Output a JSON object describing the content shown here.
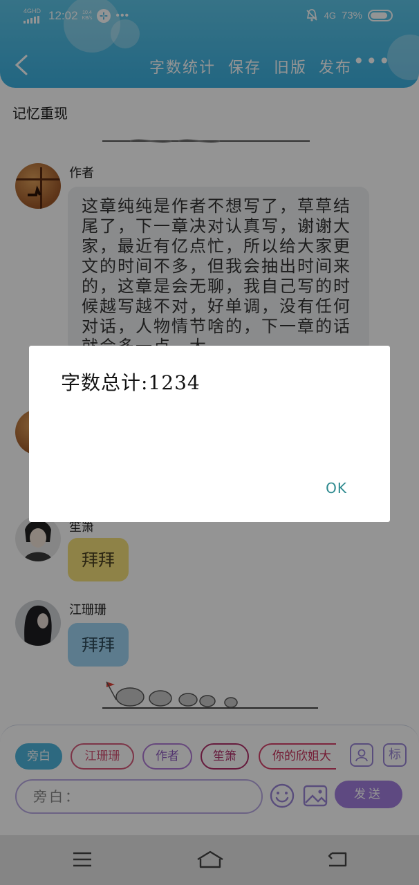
{
  "status_bar": {
    "network_type": "4GHD",
    "time": "12:02",
    "speed_value": "10.4",
    "speed_unit": "KB/s",
    "mobile_data": "4G",
    "battery": "73%"
  },
  "header": {
    "back_icon": "back-icon",
    "actions": [
      "字数统计",
      "保存",
      "旧版",
      "发布"
    ],
    "more_label": "•••"
  },
  "document": {
    "title": "记忆重现"
  },
  "messages": [
    {
      "author": "作者",
      "text": "这章纯纯是作者不想写了，草草结尾了，下一章决对认真写，谢谢大家，最近有亿点忙，所以给大家更文的时间不多，但我会抽出时间来的，这章是会无聊，我自己写的时候越写越不对，好单调，没有任何对话，人物情节啥的，下一章的话就会多一点，大"
    },
    {
      "author": "笙箫",
      "text": "拜拜"
    },
    {
      "author": "江珊珊",
      "text": "拜拜"
    }
  ],
  "composer": {
    "chips": [
      "旁白",
      "江珊珊",
      "作者",
      "笙箫",
      "你的欣姐大"
    ],
    "side_icons": [
      "person-icon",
      "标"
    ],
    "input_placeholder": "旁白：",
    "send_label": "发送"
  },
  "dialog": {
    "message": "字数总计:1234",
    "ok_label": "OK"
  },
  "colors": {
    "header": "#3cb0e0",
    "accent_purple": "#a27ede",
    "dialog_ok": "#2e8a8f",
    "yellow_bubble": "#f5e07b",
    "blue_bubble": "#9fd4f3"
  }
}
